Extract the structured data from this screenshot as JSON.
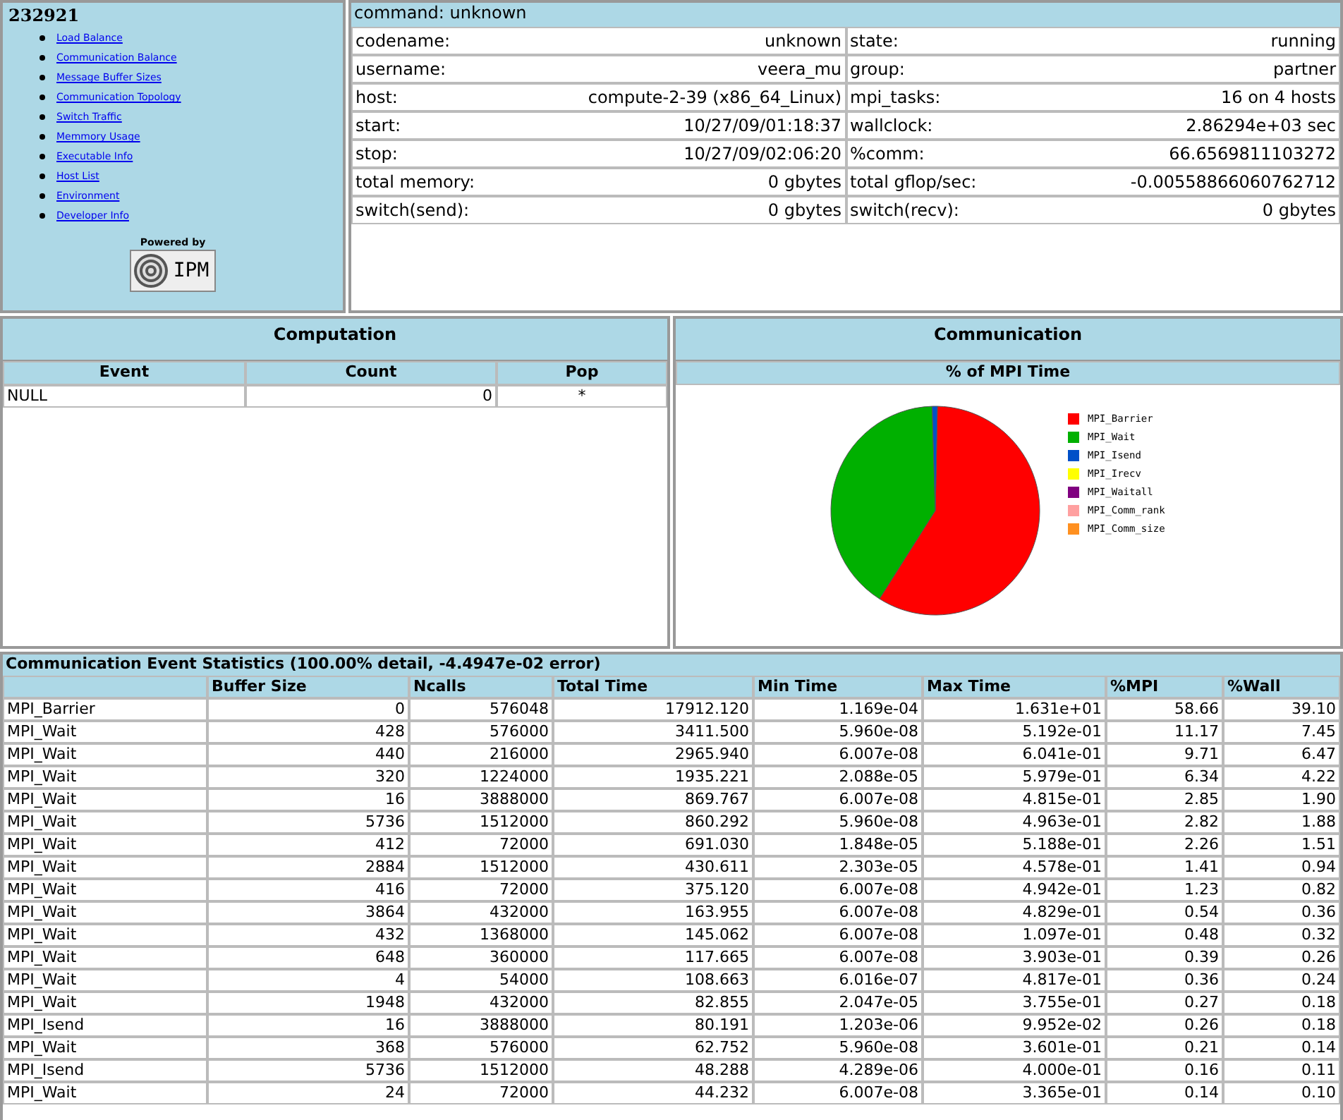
{
  "sidebar": {
    "title": "232921",
    "links": [
      "Load Balance",
      "Communication Balance",
      "Message Buffer Sizes",
      "Communication Topology",
      "Switch Traffic",
      "Memmory Usage",
      "Executable Info",
      "Host List",
      "Environment",
      "Developer Info"
    ],
    "logo": {
      "caption": "Powered by",
      "text": "IPM"
    }
  },
  "summary": {
    "command": "command: unknown",
    "rows": [
      {
        "label_1": "codename:",
        "value_1": "unknown",
        "label_2": "state:",
        "value_2": "running"
      },
      {
        "label_1": "username:",
        "value_1": "veera_mu",
        "label_2": "group:",
        "value_2": "partner"
      },
      {
        "label_1": "host:",
        "value_1": "compute-2-39 (x86_64_Linux)",
        "label_2": "mpi_tasks:",
        "value_2": "16 on 4 hosts"
      },
      {
        "label_1": "start:",
        "value_1": "10/27/09/01:18:37",
        "label_2": "wallclock:",
        "value_2": "2.86294e+03 sec"
      },
      {
        "label_1": "stop:",
        "value_1": "10/27/09/02:06:20",
        "label_2": "%comm:",
        "value_2": "66.6569811103272"
      },
      {
        "label_1": "total memory:",
        "value_1": "0 gbytes",
        "label_2": "total gflop/sec:",
        "value_2": "-0.00558866060762712"
      },
      {
        "label_1": "switch(send):",
        "value_1": "0 gbytes",
        "label_2": "switch(recv):",
        "value_2": "0 gbytes"
      }
    ]
  },
  "computation": {
    "title": "Computation",
    "columns": [
      "Event",
      "Count",
      "Pop"
    ],
    "rows": [
      [
        "NULL",
        "0",
        "*"
      ]
    ]
  },
  "communication": {
    "title": "Communication",
    "subtitle": "% of MPI Time",
    "legend": [
      {
        "label": "MPI_Barrier",
        "color": "#ff0000"
      },
      {
        "label": "MPI_Wait",
        "color": "#00b000"
      },
      {
        "label": "MPI_Isend",
        "color": "#0050c8"
      },
      {
        "label": "MPI_Irecv",
        "color": "#ffff00"
      },
      {
        "label": "MPI_Waitall",
        "color": "#800080"
      },
      {
        "label": "MPI_Comm_rank",
        "color": "#ffa0a0"
      },
      {
        "label": "MPI_Comm_size",
        "color": "#ff9020"
      }
    ]
  },
  "stats": {
    "title": "Communication Event Statistics (100.00% detail, -4.4947e-02 error)",
    "columns": [
      "",
      "Buffer Size",
      "Ncalls",
      "Total Time",
      "Min Time",
      "Max Time",
      "%MPI",
      "%Wall"
    ],
    "rows": [
      [
        "MPI_Barrier",
        "0",
        "576048",
        "17912.120",
        "1.169e-04",
        "1.631e+01",
        "58.66",
        "39.10"
      ],
      [
        "MPI_Wait",
        "428",
        "576000",
        "3411.500",
        "5.960e-08",
        "5.192e-01",
        "11.17",
        "7.45"
      ],
      [
        "MPI_Wait",
        "440",
        "216000",
        "2965.940",
        "6.007e-08",
        "6.041e-01",
        "9.71",
        "6.47"
      ],
      [
        "MPI_Wait",
        "320",
        "1224000",
        "1935.221",
        "2.088e-05",
        "5.979e-01",
        "6.34",
        "4.22"
      ],
      [
        "MPI_Wait",
        "16",
        "3888000",
        "869.767",
        "6.007e-08",
        "4.815e-01",
        "2.85",
        "1.90"
      ],
      [
        "MPI_Wait",
        "5736",
        "1512000",
        "860.292",
        "5.960e-08",
        "4.963e-01",
        "2.82",
        "1.88"
      ],
      [
        "MPI_Wait",
        "412",
        "72000",
        "691.030",
        "1.848e-05",
        "5.188e-01",
        "2.26",
        "1.51"
      ],
      [
        "MPI_Wait",
        "2884",
        "1512000",
        "430.611",
        "2.303e-05",
        "4.578e-01",
        "1.41",
        "0.94"
      ],
      [
        "MPI_Wait",
        "416",
        "72000",
        "375.120",
        "6.007e-08",
        "4.942e-01",
        "1.23",
        "0.82"
      ],
      [
        "MPI_Wait",
        "3864",
        "432000",
        "163.955",
        "6.007e-08",
        "4.829e-01",
        "0.54",
        "0.36"
      ],
      [
        "MPI_Wait",
        "432",
        "1368000",
        "145.062",
        "6.007e-08",
        "1.097e-01",
        "0.48",
        "0.32"
      ],
      [
        "MPI_Wait",
        "648",
        "360000",
        "117.665",
        "6.007e-08",
        "3.903e-01",
        "0.39",
        "0.26"
      ],
      [
        "MPI_Wait",
        "4",
        "54000",
        "108.663",
        "6.016e-07",
        "4.817e-01",
        "0.36",
        "0.24"
      ],
      [
        "MPI_Wait",
        "1948",
        "432000",
        "82.855",
        "2.047e-05",
        "3.755e-01",
        "0.27",
        "0.18"
      ],
      [
        "MPI_Isend",
        "16",
        "3888000",
        "80.191",
        "1.203e-06",
        "9.952e-02",
        "0.26",
        "0.18"
      ],
      [
        "MPI_Wait",
        "368",
        "576000",
        "62.752",
        "5.960e-08",
        "3.601e-01",
        "0.21",
        "0.14"
      ],
      [
        "MPI_Isend",
        "5736",
        "1512000",
        "48.288",
        "4.289e-06",
        "4.000e-01",
        "0.16",
        "0.11"
      ],
      [
        "MPI_Wait",
        "24",
        "72000",
        "44.232",
        "6.007e-08",
        "3.365e-01",
        "0.14",
        "0.10"
      ]
    ]
  }
}
